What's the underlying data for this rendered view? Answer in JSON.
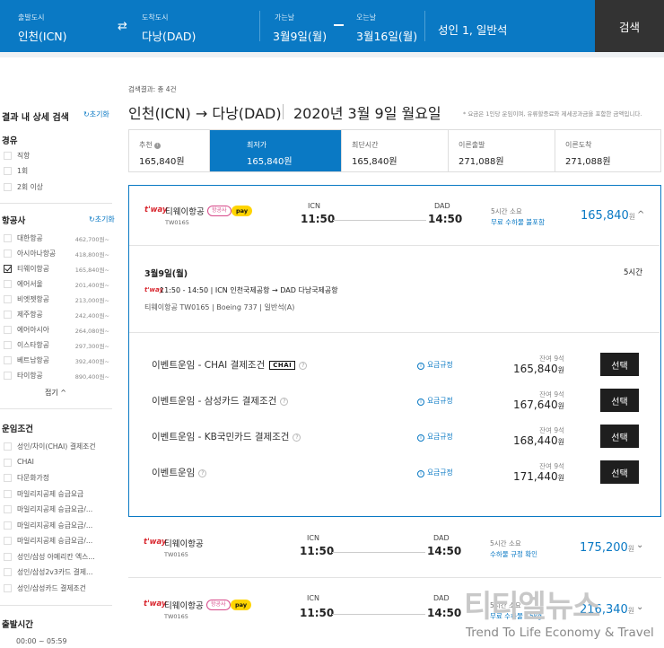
{
  "search": {
    "origin_label": "출발도시",
    "origin": "인천(ICN)",
    "dest_label": "도착도시",
    "dest": "다낭(DAD)",
    "depart_label": "가는날",
    "depart": "3월9일(월)",
    "return_label": "오는날",
    "return": "3월16일(월)",
    "passengers": "성인 1, 일반석",
    "search_button": "검색"
  },
  "sidebar": {
    "title": "결과 내 상세 검색",
    "reset": "초기화",
    "stops": {
      "title": "경유",
      "options": [
        "직항",
        "1회",
        "2회 이상"
      ]
    },
    "airlines": {
      "title": "항공사",
      "reset": "초기화",
      "options": [
        {
          "label": "대한항공",
          "price": "462,700원~",
          "checked": false
        },
        {
          "label": "아시아나항공",
          "price": "418,800원~",
          "checked": false
        },
        {
          "label": "티웨이항공",
          "price": "165,840원~",
          "checked": true
        },
        {
          "label": "에어서울",
          "price": "201,400원~",
          "checked": false
        },
        {
          "label": "비엣젯항공",
          "price": "213,000원~",
          "checked": false
        },
        {
          "label": "제주항공",
          "price": "242,400원~",
          "checked": false
        },
        {
          "label": "에어아시아",
          "price": "264,080원~",
          "checked": false
        },
        {
          "label": "이스타항공",
          "price": "297,300원~",
          "checked": false
        },
        {
          "label": "베트남항공",
          "price": "392,400원~",
          "checked": false
        },
        {
          "label": "타이항공",
          "price": "890,400원~",
          "checked": false
        }
      ],
      "collapse": "접기 ^"
    },
    "fare_conditions": {
      "title": "운임조건",
      "options": [
        "성인/차이(CHAI) 결제조건",
        "CHAI",
        "다문화가정",
        "마일리지공제 승급요금",
        "마일리지공제 승급요금/...",
        "마일리지공제 승급요금/...",
        "마일리지공제 승급요금/...",
        "성인/삼성 아메리칸 엑스...",
        "성인/삼성2v3카드 결제...",
        "성인/삼성카드 결제조건"
      ]
    },
    "depart_time": {
      "title": "출발시간",
      "first": "00:00 ~ 05:59"
    }
  },
  "main": {
    "result_meta": "검색결과: 총 4건",
    "route": "인천(ICN) → 다낭(DAD)",
    "date": "2020년 3월 9일 월요일",
    "note": "* 요금은 1인당 운임이며, 유류할증료와 제세공과금을 포함한 금액입니다.",
    "tabs": [
      {
        "label": "추천",
        "value": "165,840원"
      },
      {
        "label": "최저가",
        "value": "165,840원"
      },
      {
        "label": "최단시간",
        "value": "165,840원"
      },
      {
        "label": "이른출발",
        "value": "271,088원"
      },
      {
        "label": "이른도착",
        "value": "271,088원"
      }
    ],
    "info_glyph": "i",
    "collapse_glyph": "^",
    "expand_glyph": "⌄",
    "question_glyph": "?",
    "flights": [
      {
        "logo": "t'way",
        "airline": "티웨이항공",
        "code": "TW0165",
        "badge": "항공사",
        "pay": "pay",
        "dep_ap": "ICN",
        "dep_time": "11:50",
        "arr_ap": "DAD",
        "arr_time": "14:50",
        "duration": "5시간 소요",
        "baggage": "무료 수하물 불포함",
        "price": "165,840",
        "won": "원"
      },
      {
        "logo": "t'way",
        "airline": "티웨이항공",
        "code": "TW0165",
        "dep_ap": "ICN",
        "dep_time": "11:50",
        "arr_ap": "DAD",
        "arr_time": "14:50",
        "duration": "5시간 소요",
        "baggage": "수하물 규정 확인",
        "price": "175,200",
        "won": "원"
      },
      {
        "logo": "t'way",
        "airline": "티웨이항공",
        "code": "TW0165",
        "badge": "항공사",
        "pay": "pay",
        "dep_ap": "ICN",
        "dep_time": "11:50",
        "arr_ap": "DAD",
        "arr_time": "14:50",
        "duration": "5시간 소요",
        "baggage": "무료 수하물 15kg",
        "price": "216,340",
        "won": "원"
      }
    ],
    "detail": {
      "date": "3월9일(월)",
      "total": "5시간",
      "logo": "t'way",
      "segment": "11:50 - 14:50  |  ICN 인천국제공항  →  DAD 다낭국제공항",
      "info": "티웨이항공   TW0165  |  Boeing 737  |  일반석(A)"
    },
    "fares": [
      {
        "name": "이벤트운임 - CHAI 결제조건",
        "chai": "CHAI",
        "rule": "요금규정",
        "seats": "잔여 9석",
        "price": "165,840",
        "won": "원",
        "button": "선택"
      },
      {
        "name": "이벤트운임 - 삼성카드 결제조건",
        "rule": "요금규정",
        "seats": "잔여 9석",
        "price": "167,640",
        "won": "원",
        "button": "선택"
      },
      {
        "name": "이벤트운임 - KB국민카드 결제조건",
        "rule": "요금규정",
        "seats": "잔여 9석",
        "price": "168,440",
        "won": "원",
        "button": "선택"
      },
      {
        "name": "이벤트운임",
        "rule": "요금규정",
        "seats": "잔여 9석",
        "price": "171,440",
        "won": "원",
        "button": "선택"
      }
    ]
  },
  "watermark": {
    "title": "티티엘뉴스",
    "subtitle": "Trend To Life Economy & Travel"
  },
  "colors": {
    "accent": "#0a79c4",
    "dark_button": "#1e1e1e",
    "airline_red": "#d8262e",
    "pay_yellow": "#ffd400"
  }
}
